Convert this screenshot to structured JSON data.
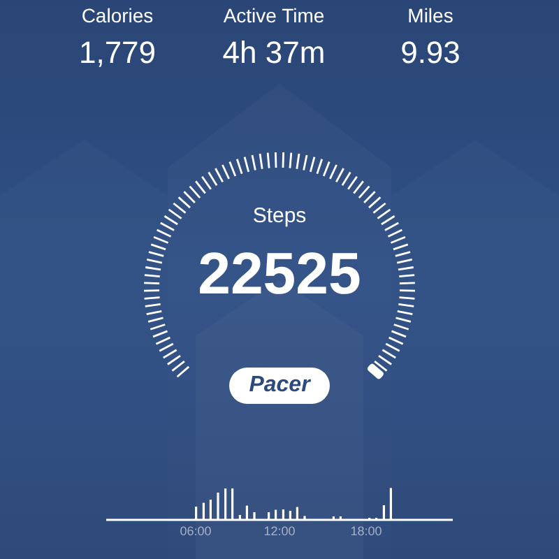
{
  "stats": [
    {
      "label": "Calories",
      "value": "1,779"
    },
    {
      "label": "Active Time",
      "value": "4h 37m"
    },
    {
      "label": "Miles",
      "value": "9.93"
    }
  ],
  "steps": {
    "label": "Steps",
    "value": "22525"
  },
  "brand": "Pacer",
  "activity": {
    "time_labels": [
      "06:00",
      "12:00",
      "18:00"
    ]
  }
}
